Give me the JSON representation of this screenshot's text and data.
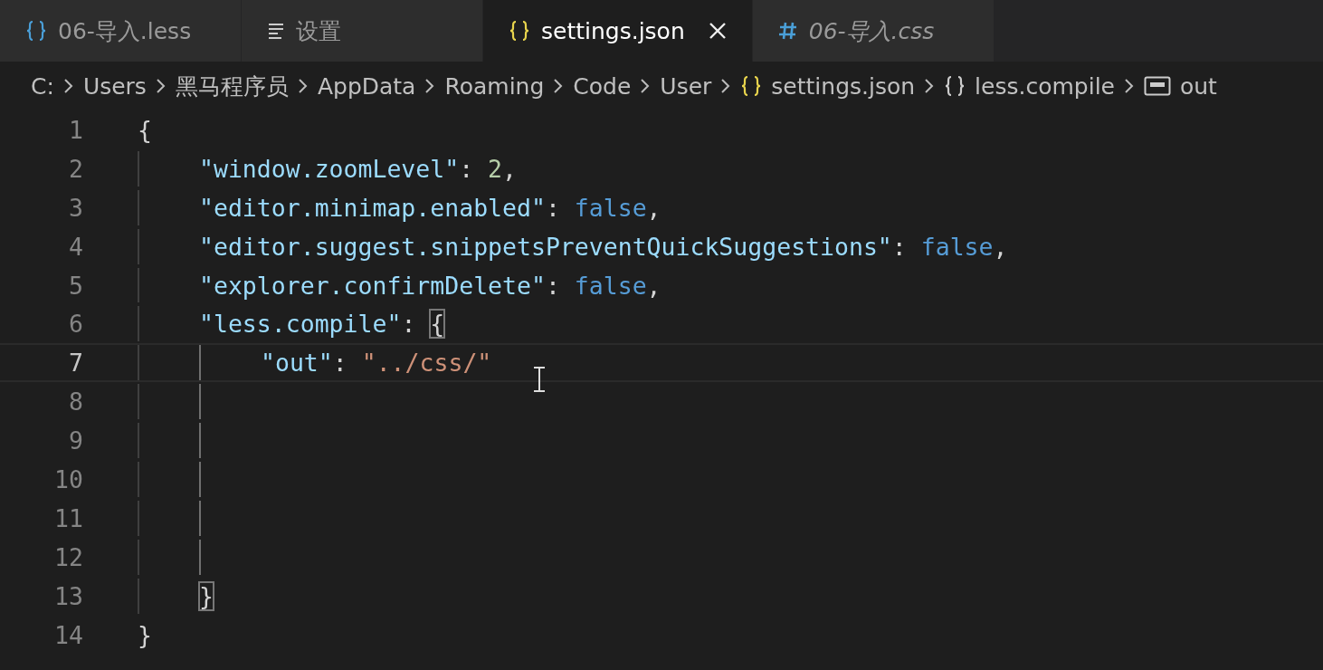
{
  "tabs": [
    {
      "kind": "json",
      "label": "06-导入.less",
      "selected": false,
      "italic": false
    },
    {
      "kind": "settings",
      "label": "设置",
      "selected": false,
      "italic": false
    },
    {
      "kind": "json",
      "label": "settings.json",
      "selected": true,
      "italic": false
    },
    {
      "kind": "css",
      "label": "06-导入.css",
      "selected": false,
      "italic": true
    }
  ],
  "breadcrumb": [
    {
      "kind": "folder",
      "label": "C:"
    },
    {
      "kind": "folder",
      "label": "Users"
    },
    {
      "kind": "folder",
      "label": "黑马程序员"
    },
    {
      "kind": "folder",
      "label": "AppData"
    },
    {
      "kind": "folder",
      "label": "Roaming"
    },
    {
      "kind": "folder",
      "label": "Code"
    },
    {
      "kind": "folder",
      "label": "User"
    },
    {
      "kind": "file",
      "label": "settings.json"
    },
    {
      "kind": "object",
      "label": "less.compile"
    },
    {
      "kind": "string",
      "label": "out"
    }
  ],
  "lines": [
    {
      "number": "1",
      "current": false,
      "tokens": [
        {
          "kind": "punct",
          "text": "{"
        }
      ],
      "children": [
        {
          "number": "2",
          "current": false,
          "tokens": [
            {
              "kind": "key",
              "text": "\"window.zoomLevel\""
            },
            {
              "kind": "punct",
              "text": ": "
            },
            {
              "kind": "number",
              "text": "2"
            },
            {
              "kind": "punct",
              "text": ","
            }
          ]
        },
        {
          "number": "3",
          "current": false,
          "tokens": [
            {
              "kind": "key",
              "text": "\"editor.minimap.enabled\""
            },
            {
              "kind": "punct",
              "text": ": "
            },
            {
              "kind": "bool",
              "text": "false"
            },
            {
              "kind": "punct",
              "text": ","
            }
          ]
        },
        {
          "number": "4",
          "current": false,
          "tokens": [
            {
              "kind": "key",
              "text": "\"editor.suggest.snippetsPreventQuickSuggestions\""
            },
            {
              "kind": "punct",
              "text": ": "
            },
            {
              "kind": "bool",
              "text": "false"
            },
            {
              "kind": "punct",
              "text": ","
            }
          ]
        },
        {
          "number": "5",
          "current": false,
          "tokens": [
            {
              "kind": "key",
              "text": "\"explorer.confirmDelete\""
            },
            {
              "kind": "punct",
              "text": ": "
            },
            {
              "kind": "bool",
              "text": "false"
            },
            {
              "kind": "punct",
              "text": ","
            }
          ]
        },
        {
          "number": "6",
          "current": false,
          "tokens": [
            {
              "kind": "key",
              "text": "\"less.compile\""
            },
            {
              "kind": "punct",
              "text": ": "
            },
            {
              "kind": "match",
              "text": "{"
            }
          ],
          "children": [
            {
              "number": "7",
              "current": true,
              "tokens": [
                {
                  "kind": "key",
                  "text": "\"out\""
                },
                {
                  "kind": "punct",
                  "text": ": "
                },
                {
                  "kind": "string",
                  "text": "\"../css/\""
                }
              ]
            },
            {
              "number": "8",
              "current": false
            },
            {
              "number": "9",
              "current": false
            },
            {
              "number": "10",
              "current": false
            },
            {
              "number": "11",
              "current": false
            },
            {
              "number": "12",
              "current": false
            }
          ]
        },
        {
          "number": "13",
          "current": false,
          "tokens": [
            {
              "kind": "match",
              "text": "}"
            }
          ]
        }
      ]
    },
    {
      "number": "14",
      "current": false,
      "tokens": [
        {
          "kind": "punct",
          "text": "}"
        }
      ]
    }
  ]
}
